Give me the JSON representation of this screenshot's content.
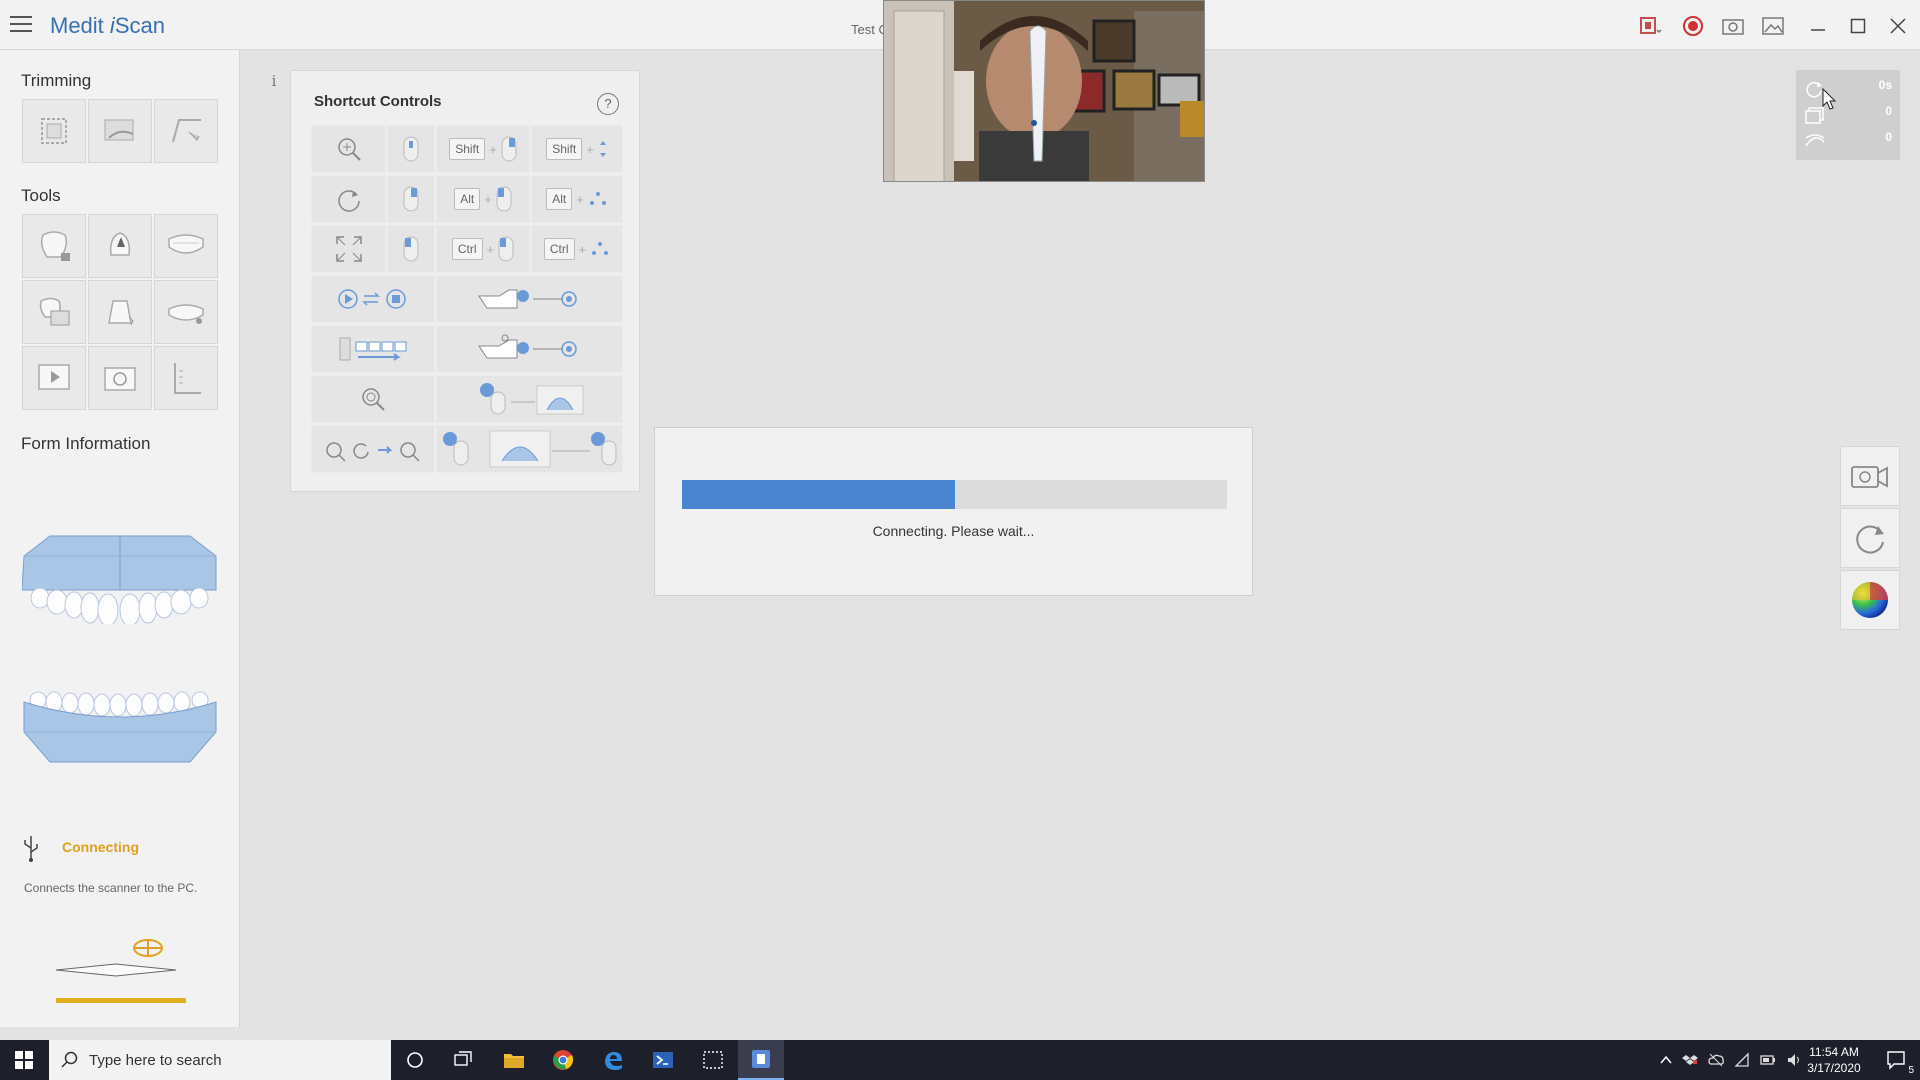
{
  "app": {
    "title_part1": "Medit ",
    "title_part2": "i",
    "title_part3": "Scan",
    "case_title": "Test C"
  },
  "sidebar": {
    "trimming_title": "Trimming",
    "tools_title": "Tools",
    "form_info_title": "Form Information",
    "status": {
      "label": "Connecting",
      "description": "Connects the scanner to the PC."
    }
  },
  "shortcuts": {
    "title": "Shortcut Controls",
    "help": "?",
    "rows": [
      {
        "key1": "Shift",
        "key2": "Shift"
      },
      {
        "key1": "Alt",
        "key2": "Alt"
      },
      {
        "key1": "Ctrl",
        "key2": "Ctrl"
      }
    ],
    "plus": "+"
  },
  "info": "i",
  "dialog": {
    "message": "Connecting. Please wait...",
    "progress": 0.5
  },
  "stats": {
    "time": "0s",
    "count1": "0",
    "count2": "0"
  },
  "taskbar": {
    "search_placeholder": "Type here to search",
    "time": "11:54 AM",
    "date": "3/17/2020",
    "notifications": "5"
  },
  "colors": {
    "accent": "#3a6fb0",
    "progress": "#4a86d0",
    "status": "#e0a020"
  }
}
